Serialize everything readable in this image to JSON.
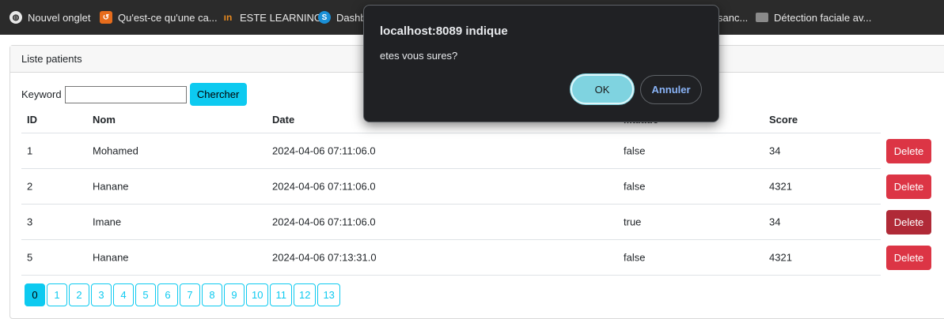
{
  "bookmarks": [
    {
      "label": "Nouvel onglet",
      "icon": "globe-icon"
    },
    {
      "label": "Qu'est-ce qu'une ca...",
      "icon": "orange-site-icon"
    },
    {
      "label": "ESTE LEARNING",
      "icon": "este-logo-icon"
    },
    {
      "label": "Dashb",
      "icon": "dashboard-s-icon"
    },
    {
      "label": "sanc...",
      "icon": ""
    },
    {
      "label": "Détection faciale av...",
      "icon": "image-icon"
    }
  ],
  "card": {
    "title": "Liste patients"
  },
  "search": {
    "label": "Keyword",
    "value": "",
    "button": "Chercher"
  },
  "table": {
    "headers": {
      "id": "ID",
      "nom": "Nom",
      "date": "Date",
      "malade": "Malade",
      "score": "Score"
    },
    "rows": [
      {
        "id": "1",
        "nom": "Mohamed",
        "date": "2024-04-06 07:11:06.0",
        "malade": "false",
        "score": "34",
        "action": "Delete"
      },
      {
        "id": "2",
        "nom": "Hanane",
        "date": "2024-04-06 07:11:06.0",
        "malade": "false",
        "score": "4321",
        "action": "Delete"
      },
      {
        "id": "3",
        "nom": "Imane",
        "date": "2024-04-06 07:11:06.0",
        "malade": "true",
        "score": "34",
        "action": "Delete"
      },
      {
        "id": "5",
        "nom": "Hanane",
        "date": "2024-04-06 07:13:31.0",
        "malade": "false",
        "score": "4321",
        "action": "Delete"
      }
    ]
  },
  "pagination": {
    "pages": [
      "0",
      "1",
      "2",
      "3",
      "4",
      "5",
      "6",
      "7",
      "8",
      "9",
      "10",
      "11",
      "12",
      "13"
    ],
    "active": "0"
  },
  "dialog": {
    "title": "localhost:8089 indique",
    "message": "etes vous sures?",
    "ok": "OK",
    "cancel": "Annuler"
  },
  "colors": {
    "accent": "#0dcaf0",
    "danger": "#dc3545",
    "dialog_bg": "#202124"
  }
}
